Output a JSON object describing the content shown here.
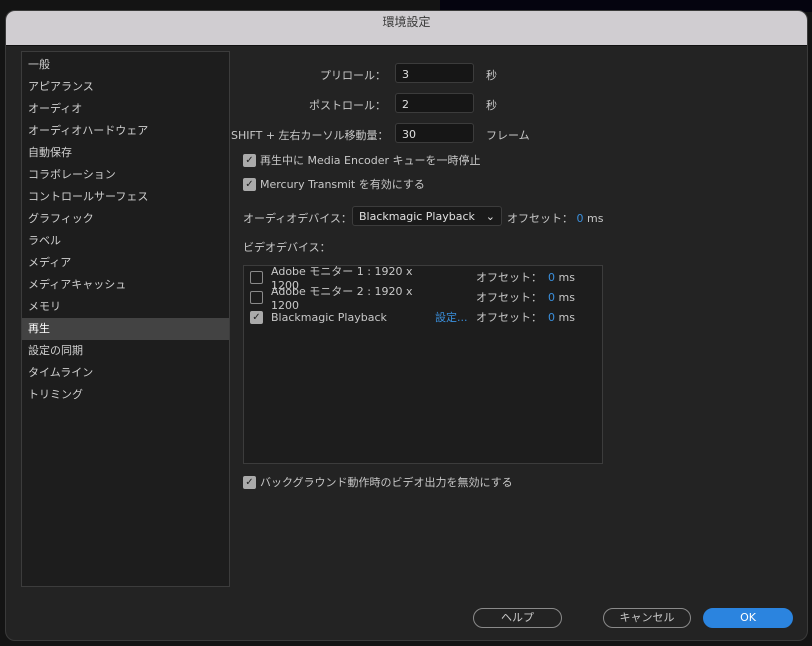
{
  "title": "環境設定",
  "sidebar": {
    "items": [
      "一般",
      "アピアランス",
      "オーディオ",
      "オーディオハードウェア",
      "自動保存",
      "コラボレーション",
      "コントロールサーフェス",
      "グラフィック",
      "ラベル",
      "メディア",
      "メディアキャッシュ",
      "メモリ",
      "再生",
      "設定の同期",
      "タイムライン",
      "トリミング"
    ],
    "selected": "再生"
  },
  "preroll": {
    "label": "プリロール：",
    "value": "3",
    "unit": "秒"
  },
  "postroll": {
    "label": "ポストロール：",
    "value": "2",
    "unit": "秒"
  },
  "shift": {
    "label": "SHIFT + 左右カーソル移動量：",
    "value": "30",
    "unit": "フレーム"
  },
  "pause_me": {
    "label": "再生中に Media Encoder キューを一時停止",
    "checked": true
  },
  "mercury": {
    "label": "Mercury Transmit を有効にする",
    "checked": true
  },
  "audio": {
    "label": "オーディオデバイス：",
    "value": "Blackmagic Playback",
    "offset_label": "オフセット：",
    "offset_value": "0",
    "offset_unit": "ms"
  },
  "video": {
    "label": "ビデオデバイス：",
    "devices": [
      {
        "name": "Adobe モニター 1 : 1920 x 1200",
        "checked": false,
        "offset_label": "オフセット：",
        "offset": "0",
        "unit": "ms"
      },
      {
        "name": "Adobe モニター 2 : 1920 x 1200",
        "checked": false,
        "offset_label": "オフセット：",
        "offset": "0",
        "unit": "ms"
      },
      {
        "name": "Blackmagic Playback",
        "checked": true,
        "settings": "設定...",
        "offset_label": "オフセット：",
        "offset": "0",
        "unit": "ms"
      }
    ]
  },
  "background": {
    "label": "バックグラウンド動作時のビデオ出力を無効にする",
    "checked": true
  },
  "buttons": {
    "help": "ヘルプ",
    "cancel": "キャンセル",
    "ok": "OK"
  },
  "colors": {
    "accent": "#2b84df",
    "titlebar": "#d0cdd1",
    "panel": "#232323"
  }
}
